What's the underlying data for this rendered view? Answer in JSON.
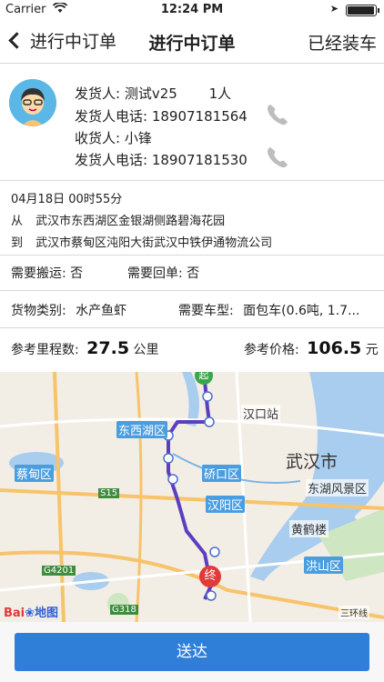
{
  "status_bar": {
    "carrier": "Carrier",
    "time": "12:24 PM",
    "battery_level": 0.95
  },
  "nav": {
    "back_label": "进行中订单",
    "title": "进行中订单",
    "right_action": "已经装车"
  },
  "shipper": {
    "sender_label": "发货人:",
    "sender_name": "测试v25",
    "people_count": "1人",
    "sender_phone_label": "发货人电话:",
    "sender_phone": "18907181564",
    "receiver_label": "收货人:",
    "receiver_name": "小锋",
    "receiver_phone_label": "发货人电话:",
    "receiver_phone": "18907181530"
  },
  "route": {
    "datetime": "04月18日 00时55分",
    "from_label": "从",
    "from_address": "武汉市东西湖区金银湖侧路碧海花园",
    "to_label": "到",
    "to_address": "武汉市蔡甸区沌阳大街武汉中铁伊通物流公司"
  },
  "services": {
    "carry_label": "需要搬运:",
    "carry_value": "否",
    "receipt_label": "需要回单:",
    "receipt_value": "否"
  },
  "cargo": {
    "type_label": "货物类别:",
    "type_value": "水产鱼虾",
    "vehicle_label": "需要车型:",
    "vehicle_value": "面包车(0.6吨, 1.7..."
  },
  "reference": {
    "mileage_label": "参考里程数:",
    "mileage_value": "27.5",
    "mileage_unit": "公里",
    "price_label": "参考价格:",
    "price_value": "106.5",
    "price_unit": "元"
  },
  "map": {
    "labels": [
      "汉口站",
      "东西湖区",
      "武汉市",
      "蔡甸区",
      "硚口区",
      "东湖风景区",
      "汉阳区",
      "黄鹤楼",
      "洪山区",
      "S15",
      "G4201",
      "G318",
      "三环线"
    ],
    "start_marker": "起",
    "end_marker": "终",
    "logo_left": "Bai",
    "logo_right": "地图",
    "colors": {
      "route": "#5b3fbf",
      "water": "#a9cdee",
      "road": "#f7c36b",
      "end_marker": "#e03b3b"
    }
  },
  "actions": {
    "deliver_label": "送达"
  }
}
